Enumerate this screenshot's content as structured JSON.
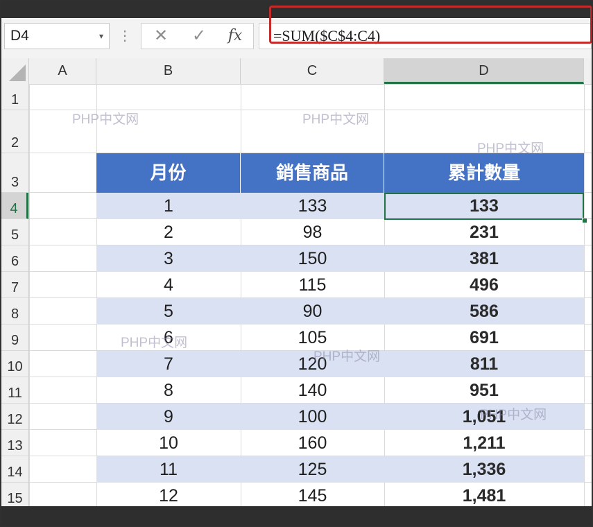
{
  "name_box": {
    "value": "D4"
  },
  "formula_bar": {
    "cancel_glyph": "✕",
    "enter_glyph": "✓",
    "fx_label": "fx",
    "formula": "=SUM($C$4:C4)"
  },
  "columns": [
    "A",
    "B",
    "C",
    "D"
  ],
  "active_column": "D",
  "rows": [
    "1",
    "2",
    "3",
    "4",
    "5",
    "6",
    "7",
    "8",
    "9",
    "10",
    "11",
    "12",
    "13",
    "14",
    "15"
  ],
  "active_row": "4",
  "table": {
    "headers": [
      "月份",
      "銷售商品",
      "累計數量"
    ],
    "rows": [
      [
        "1",
        "133",
        "133"
      ],
      [
        "2",
        "98",
        "231"
      ],
      [
        "3",
        "150",
        "381"
      ],
      [
        "4",
        "115",
        "496"
      ],
      [
        "5",
        "90",
        "586"
      ],
      [
        "6",
        "105",
        "691"
      ],
      [
        "7",
        "120",
        "811"
      ],
      [
        "8",
        "140",
        "951"
      ],
      [
        "9",
        "100",
        "1,051"
      ],
      [
        "10",
        "160",
        "1,211"
      ],
      [
        "11",
        "125",
        "1,336"
      ],
      [
        "12",
        "145",
        "1,481"
      ]
    ]
  },
  "watermark_text": "PHP中文网",
  "colors": {
    "header_fill": "#4472c4",
    "band_fill": "#d9e1f2",
    "selection": "#217346",
    "highlight_box": "#c42b2b"
  }
}
